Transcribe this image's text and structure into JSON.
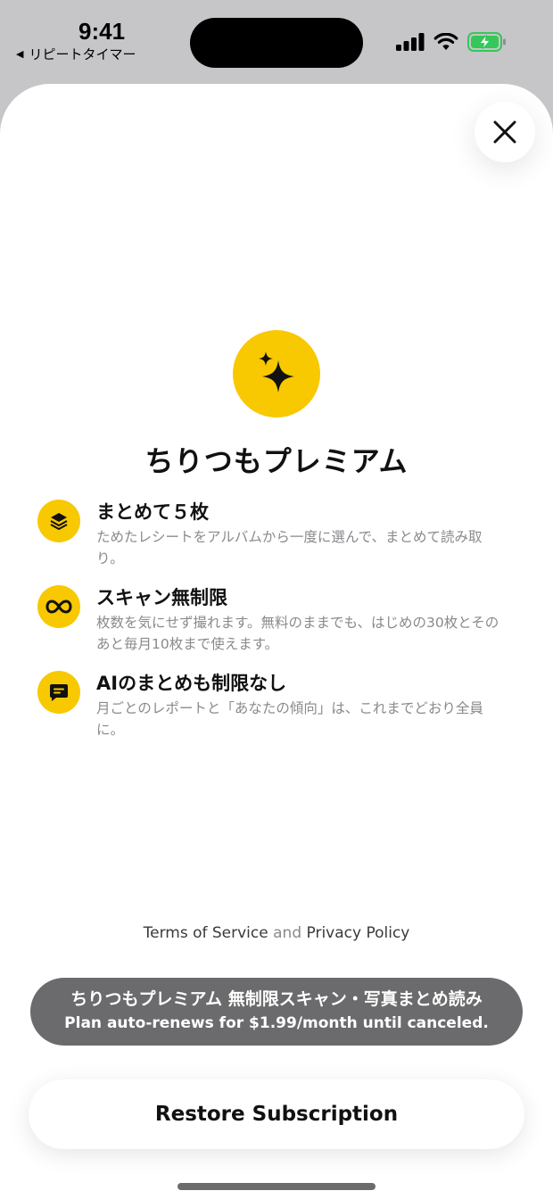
{
  "status_bar": {
    "time": "9:41",
    "back_app": "リピートタイマー",
    "back_arrow": "◀",
    "icons": [
      "cellular-signal-icon",
      "wifi-icon",
      "battery-charging-icon"
    ],
    "battery_color": "#34c759"
  },
  "paywall": {
    "title": "ちりつもプレミアム",
    "hero_icon": "sparkles-icon",
    "accent_color": "#f8c800",
    "features": [
      {
        "icon": "stack-icon",
        "title": "まとめて５枚",
        "desc": "ためたレシートをアルバムから一度に選んで、まとめて読み取り。"
      },
      {
        "icon": "infinity-icon",
        "title": "スキャン無制限",
        "desc": "枚数を気にせず撮れます。無料のままでも、はじめの30枚とそのあと毎月10枚まで使えます。"
      },
      {
        "icon": "chat-icon",
        "title": "AIのまとめも制限なし",
        "desc": "月ごとのレポートと「あなたの傾向」は、これまでどおり全員に。"
      }
    ],
    "legal": {
      "terms": "Terms of Service",
      "and": "and",
      "privacy": "Privacy Policy"
    },
    "toast": {
      "line1": "ちりつもプレミアム 無制限スキャン・写真まとめ読み",
      "line2": "Plan auto-renews for $1.99/month until canceled."
    },
    "restore_label": "Restore Subscription",
    "close_icon": "close-icon"
  }
}
